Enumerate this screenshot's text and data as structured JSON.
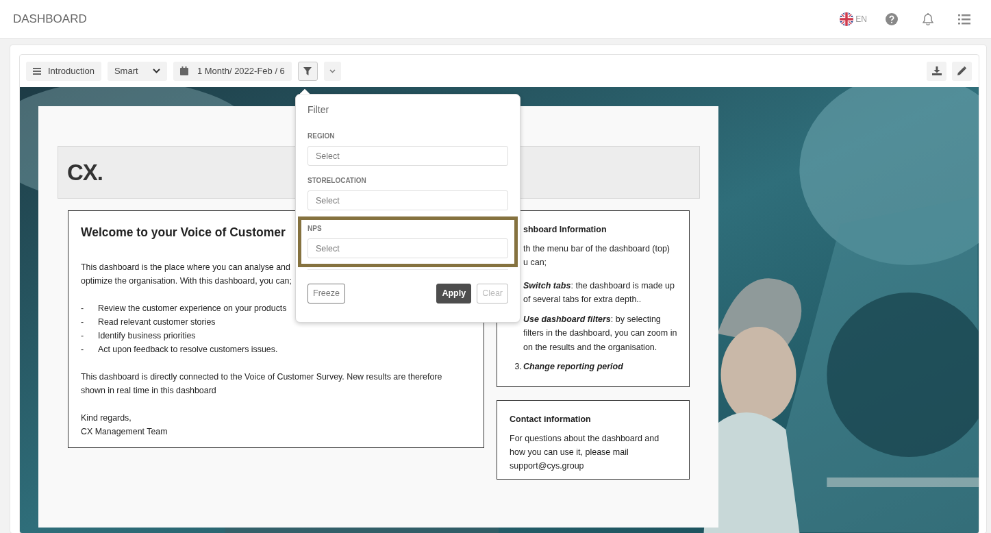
{
  "header": {
    "title": "DASHBOARD",
    "language": "EN"
  },
  "toolbar": {
    "page_button": "Introduction",
    "view_select": "Smart",
    "period_button": "1 Month/ 2022-Feb / 6",
    "filter_active": true
  },
  "banner": {
    "title": "CX."
  },
  "welcome": {
    "title": "Welcome to your Voice of Customer",
    "blocks": [
      {
        "kind": "para",
        "lines": [
          "This dashboard is the place where you can analyse and",
          "optimize the organisation. With this dashboard, you can;"
        ]
      },
      {
        "kind": "bullets",
        "items": [
          {
            "marker": "-",
            "text": "Review the customer experience on your products"
          },
          {
            "marker": "-",
            "text": "Read relevant customer stories"
          },
          {
            "marker": "-",
            "text": "Identify business priorities"
          },
          {
            "marker": "-",
            "text": "Act upon feedback to resolve customers issues."
          }
        ]
      },
      {
        "kind": "para",
        "lines": [
          "This dashboard is directly connected to the Voice of Customer Survey. New results are therefore",
          "shown in real time in this dashboard"
        ]
      },
      {
        "kind": "para",
        "lines": [
          "Kind regards,",
          "CX Management Team"
        ]
      }
    ]
  },
  "info": {
    "title": "shboard Information",
    "intro_lines": [
      "th the menu bar of the dashboard (top)",
      "u can;"
    ],
    "items": [
      {
        "term": "Switch tabs",
        "text": ": the dashboard is made up of several tabs for extra depth.."
      },
      {
        "term": "Use dashboard filters",
        "text": ": by selecting filters in the dashboard, you can zoom in on the results and the organisation."
      },
      {
        "number": "3.",
        "term": "Change reporting period"
      }
    ]
  },
  "contact": {
    "title": "Contact information",
    "text": "For questions about the dashboard and how you can use it, please mail support@cys.group"
  },
  "filter_popover": {
    "title": "Filter",
    "fields": [
      {
        "label": "REGION",
        "placeholder": "Select",
        "highlighted": false
      },
      {
        "label": "STORELOCATION",
        "placeholder": "Select",
        "highlighted": false
      },
      {
        "label": "NPS",
        "placeholder": "Select",
        "highlighted": true
      }
    ],
    "buttons": [
      {
        "label": "Freeze",
        "kind": "outline",
        "disabled": false
      },
      {
        "label": "Apply",
        "kind": "primary",
        "disabled": false
      },
      {
        "label": "Clear",
        "kind": "outline",
        "disabled": true
      }
    ]
  }
}
